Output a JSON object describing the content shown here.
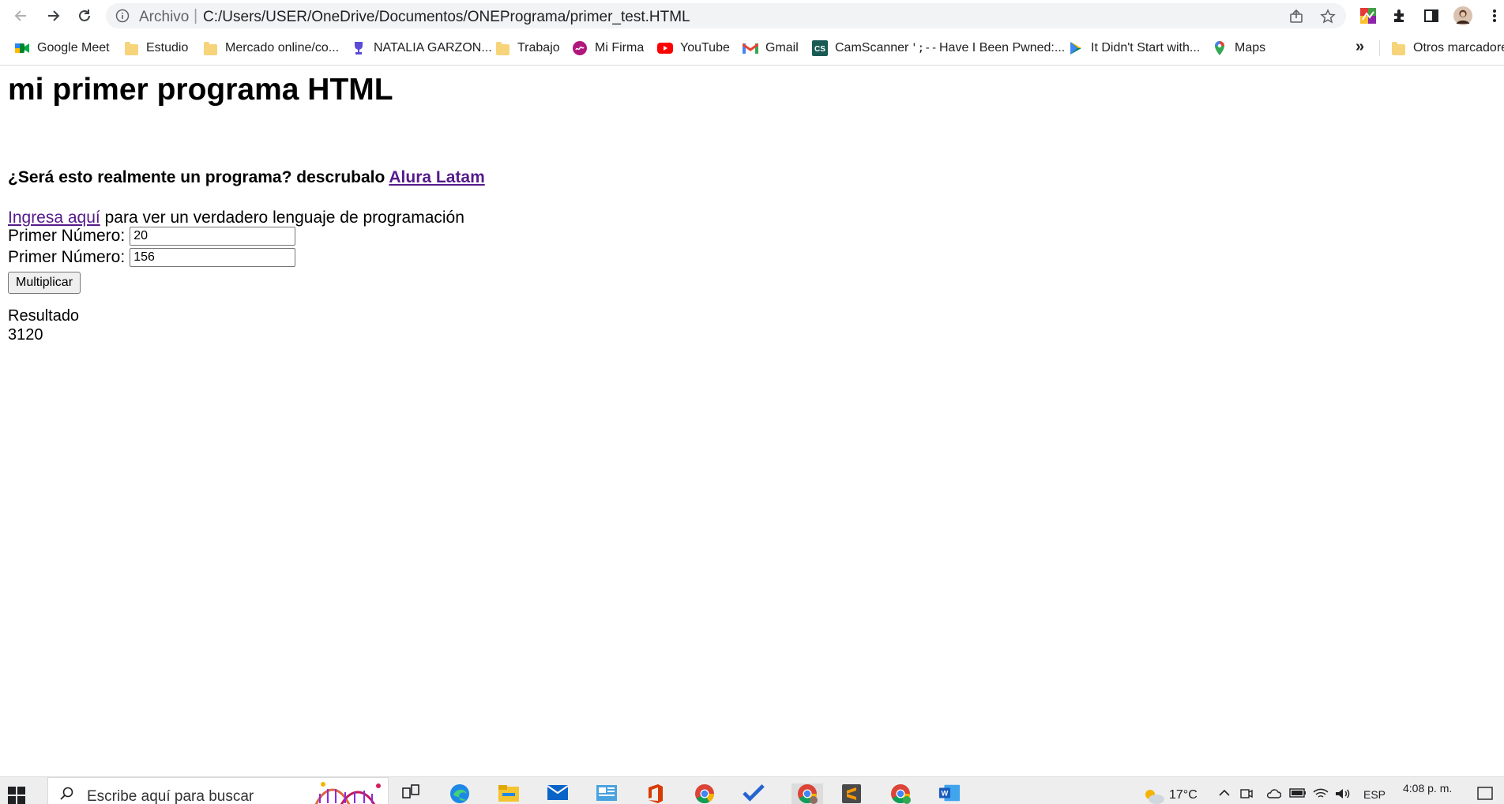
{
  "browser": {
    "scheme_label": "Archivo",
    "url": "C:/Users/USER/OneDrive/Documentos/ONEPrograma/primer_test.HTML"
  },
  "bookmarks": [
    {
      "label": "Google Meet",
      "icon": "google-meet-icon"
    },
    {
      "label": "Estudio",
      "icon": "folder-icon"
    },
    {
      "label": "Mercado online/co...",
      "icon": "folder-icon"
    },
    {
      "label": "NATALIA GARZON...",
      "icon": "trophy-icon"
    },
    {
      "label": "Trabajo",
      "icon": "folder-icon"
    },
    {
      "label": "Mi Firma",
      "icon": "signature-icon"
    },
    {
      "label": "YouTube",
      "icon": "youtube-icon"
    },
    {
      "label": "Gmail",
      "icon": "gmail-icon"
    },
    {
      "label": "CamScanner",
      "icon": "camscanner-icon"
    },
    {
      "label": "Have I Been Pwned:...",
      "icon": "hibp-icon"
    },
    {
      "label": "It Didn't Start with...",
      "icon": "play-books-icon"
    },
    {
      "label": "Maps",
      "icon": "maps-icon"
    }
  ],
  "bookmarks_more": "»",
  "other_bookmarks": "Otros marcadores",
  "page": {
    "title": "mi primer programa HTML",
    "question": "¿Será esto realmente un programa? descrubalo",
    "question_link": "Alura Latam",
    "ingresa_link": "Ingresa aquí",
    "ingresa_rest": "para ver un verdadero lenguaje de programación",
    "field1_label": "Primer Número:",
    "field1_value": "20",
    "field2_label": "Primer Número:",
    "field2_value": "156",
    "button_label": "Multiplicar",
    "result_label": "Resultado",
    "result_value": "3120"
  },
  "taskbar": {
    "search_placeholder": "Escribe aquí para buscar",
    "temperature": "17°C",
    "language": "ESP",
    "time": "4:08 p. m."
  }
}
